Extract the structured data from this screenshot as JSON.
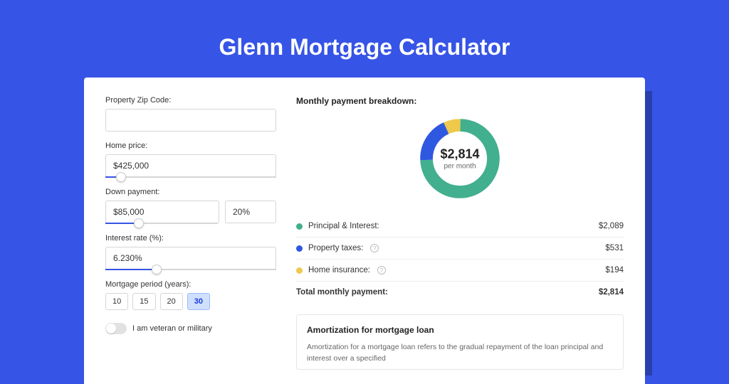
{
  "title": "Glenn Mortgage Calculator",
  "form": {
    "zip_label": "Property Zip Code:",
    "zip_value": "",
    "home_price_label": "Home price:",
    "home_price_value": "$425,000",
    "down_payment_label": "Down payment:",
    "down_payment_value": "$85,000",
    "down_payment_pct": "20%",
    "interest_label": "Interest rate (%):",
    "interest_value": "6.230%",
    "period_label": "Mortgage period (years):",
    "periods": {
      "p10": "10",
      "p15": "15",
      "p20": "20",
      "p30": "30"
    },
    "period_selected": "30",
    "veteran_label": "I am veteran or military"
  },
  "breakdown": {
    "title": "Monthly payment breakdown:",
    "center_amount": "$2,814",
    "center_sub": "per month",
    "rows": {
      "pi_label": "Principal & Interest:",
      "pi_value": "$2,089",
      "tax_label": "Property taxes:",
      "tax_value": "$531",
      "ins_label": "Home insurance:",
      "ins_value": "$194",
      "total_label": "Total monthly payment:",
      "total_value": "$2,814"
    }
  },
  "amort": {
    "title": "Amortization for mortgage loan",
    "text": "Amortization for a mortgage loan refers to the gradual repayment of the loan principal and interest over a specified"
  },
  "chart_data": {
    "type": "pie",
    "title": "Monthly payment breakdown",
    "series": [
      {
        "name": "Principal & Interest",
        "value": 2089,
        "color": "#42af8e"
      },
      {
        "name": "Property taxes",
        "value": 531,
        "color": "#2f58e0"
      },
      {
        "name": "Home insurance",
        "value": 194,
        "color": "#efc94c"
      }
    ],
    "total": 2814,
    "center_label": "$2,814 per month"
  }
}
